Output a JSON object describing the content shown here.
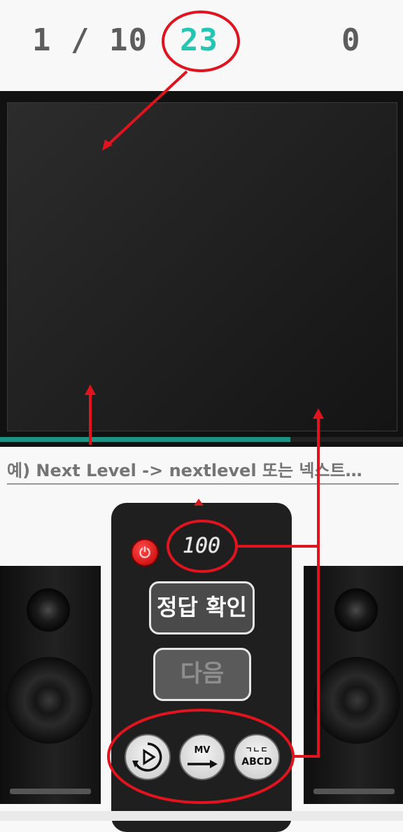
{
  "header": {
    "progress": "1 / 10",
    "timer": "23",
    "score": "0"
  },
  "video": {
    "progress_fraction": 0.72
  },
  "hint": {
    "placeholder": "예) Next Level -> nextlevel 또는 넥스트…"
  },
  "remote": {
    "power_icon": "power-icon",
    "display_value": "100",
    "check_answer_label": "정답 확인",
    "next_label": "다음",
    "replay_icon": "replay-icon",
    "mv_label": "MV",
    "lang_top": "ㄱㄴㄷ",
    "lang_bottom": "ABCD"
  },
  "colors": {
    "accent": "#23c6b2",
    "progress": "#1d9384",
    "annotation": "#e0141e"
  }
}
